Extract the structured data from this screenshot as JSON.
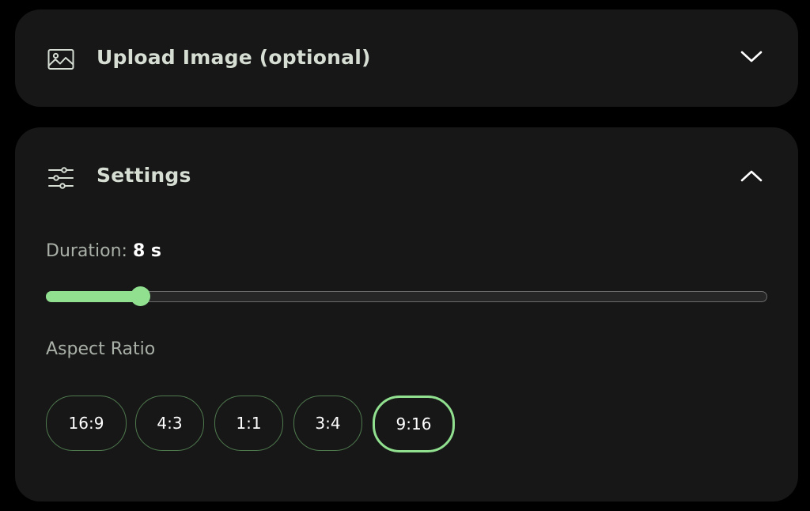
{
  "upload": {
    "title": "Upload Image (optional)",
    "icon": "image-icon",
    "chevron": "chevron-down-icon",
    "expanded": false
  },
  "settings": {
    "title": "Settings",
    "icon": "sliders-icon",
    "chevron": "chevron-up-icon",
    "expanded": true,
    "duration": {
      "label": "Duration: ",
      "value": "8 s",
      "fill_fraction": 0.13
    },
    "aspect_ratio": {
      "label": "Aspect Ratio",
      "options": [
        "16:9",
        "4:3",
        "1:1",
        "3:4",
        "9:16"
      ],
      "selected": "9:16"
    }
  },
  "colors": {
    "background": "#000000",
    "panel": "#171717",
    "accent": "#90e08f",
    "muted_text": "#a9b0a7",
    "title_text": "#d6ded4",
    "option_border": "#4f7a4e"
  }
}
